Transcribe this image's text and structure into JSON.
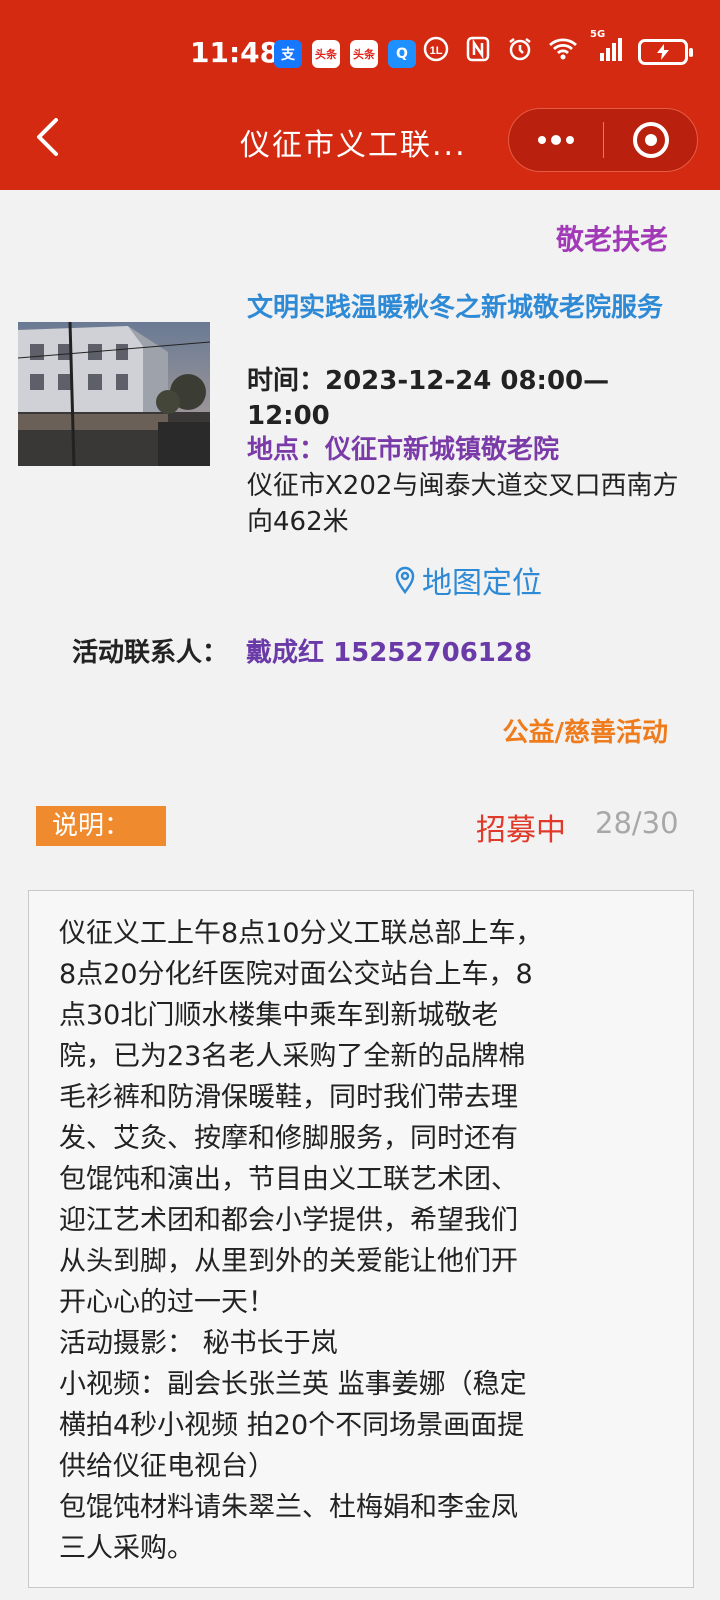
{
  "status_bar": {
    "time": "11:48",
    "apps": [
      {
        "icon": "alipay-icon",
        "glyph": "支",
        "color": "#1677ff"
      },
      {
        "icon": "news-app-icon",
        "glyph": "头条",
        "color": "#e0251a"
      },
      {
        "icon": "news-app-icon-2",
        "glyph": "头条",
        "color": "#e0251a"
      },
      {
        "icon": "search-app-icon",
        "glyph": "Q",
        "color": "#1e90ff"
      }
    ],
    "signal_label": "5G",
    "battery_icon": "charging-battery-icon"
  },
  "nav": {
    "title": "仪征市义工联..."
  },
  "event": {
    "category": "敬老扶老",
    "title": "文明实践温暖秋冬之新城敬老院服务",
    "time_line1": "时间：2023-12-24 08:00—",
    "time_line2": "12:00",
    "place": "地点：仪征市新城镇敬老院",
    "address": "仪征市X202与闽泰大道交叉口西南方向462米",
    "map_link": "地图定位",
    "contact_label": "活动联系人：",
    "contact_value": "戴成红 15252706128",
    "type": "公益/慈善活动",
    "description_label": "说明：",
    "recruit_status": "招募中",
    "recruit_count": "28/30",
    "description_lines": [
      "仪征义工上午8点10分义工联总部上车，",
      "8点20分化纤医院对面公交站台上车，8",
      "点30北门顺水楼集中乘车到新城敬老",
      "院，已为23名老人采购了全新的品牌棉",
      "毛衫裤和防滑保暖鞋，同时我们带去理",
      "发、艾灸、按摩和修脚服务，同时还有",
      "包馄饨和演出，节目由义工联艺术团、",
      "迎江艺术团和都会小学提供，希望我们",
      "从头到脚，从里到外的关爱能让他们开",
      "开心心的过一天！",
      "活动摄影：  秘书长于岚",
      "小视频：副会长张兰英 监事姜娜（稳定",
      "横拍4秒小视频 拍20个不同场景画面提",
      "供给仪征电视台）",
      "包馄饨材料请朱翠兰、杜梅娟和李金凤",
      "三人采购。"
    ]
  },
  "colors": {
    "header": "#d42a12",
    "title_blue": "#2f8ad6",
    "purple": "#7a3aa8",
    "orange": "#f08a2e",
    "recruit_red": "#e03a2a"
  }
}
